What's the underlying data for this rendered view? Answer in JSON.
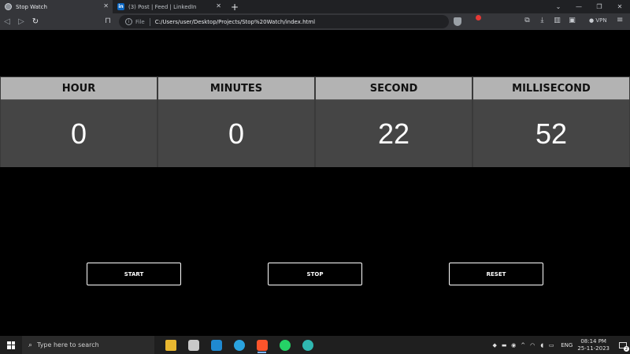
{
  "browser": {
    "tabs": [
      {
        "title": "Stop Watch",
        "active": true
      },
      {
        "title": "(3) Post | Feed | LinkedIn",
        "active": false,
        "favicon": "in"
      }
    ],
    "new_tab": "+",
    "address": {
      "scheme": "File",
      "url": "C:/Users/user/Desktop/Projects/Stop%20Watch/index.html"
    },
    "vpn_label": "VPN"
  },
  "stopwatch": {
    "units": [
      {
        "label": "HOUR",
        "value": "0"
      },
      {
        "label": "MINUTES",
        "value": "0"
      },
      {
        "label": "SECOND",
        "value": "22"
      },
      {
        "label": "MILLISECOND",
        "value": "52"
      }
    ],
    "buttons": {
      "start": "START",
      "stop": "STOP",
      "reset": "RESET"
    }
  },
  "taskbar": {
    "search_placeholder": "Type here to search",
    "language": "ENG",
    "time": "08:14 PM",
    "date": "25-11-2023",
    "notification_count": "2"
  }
}
